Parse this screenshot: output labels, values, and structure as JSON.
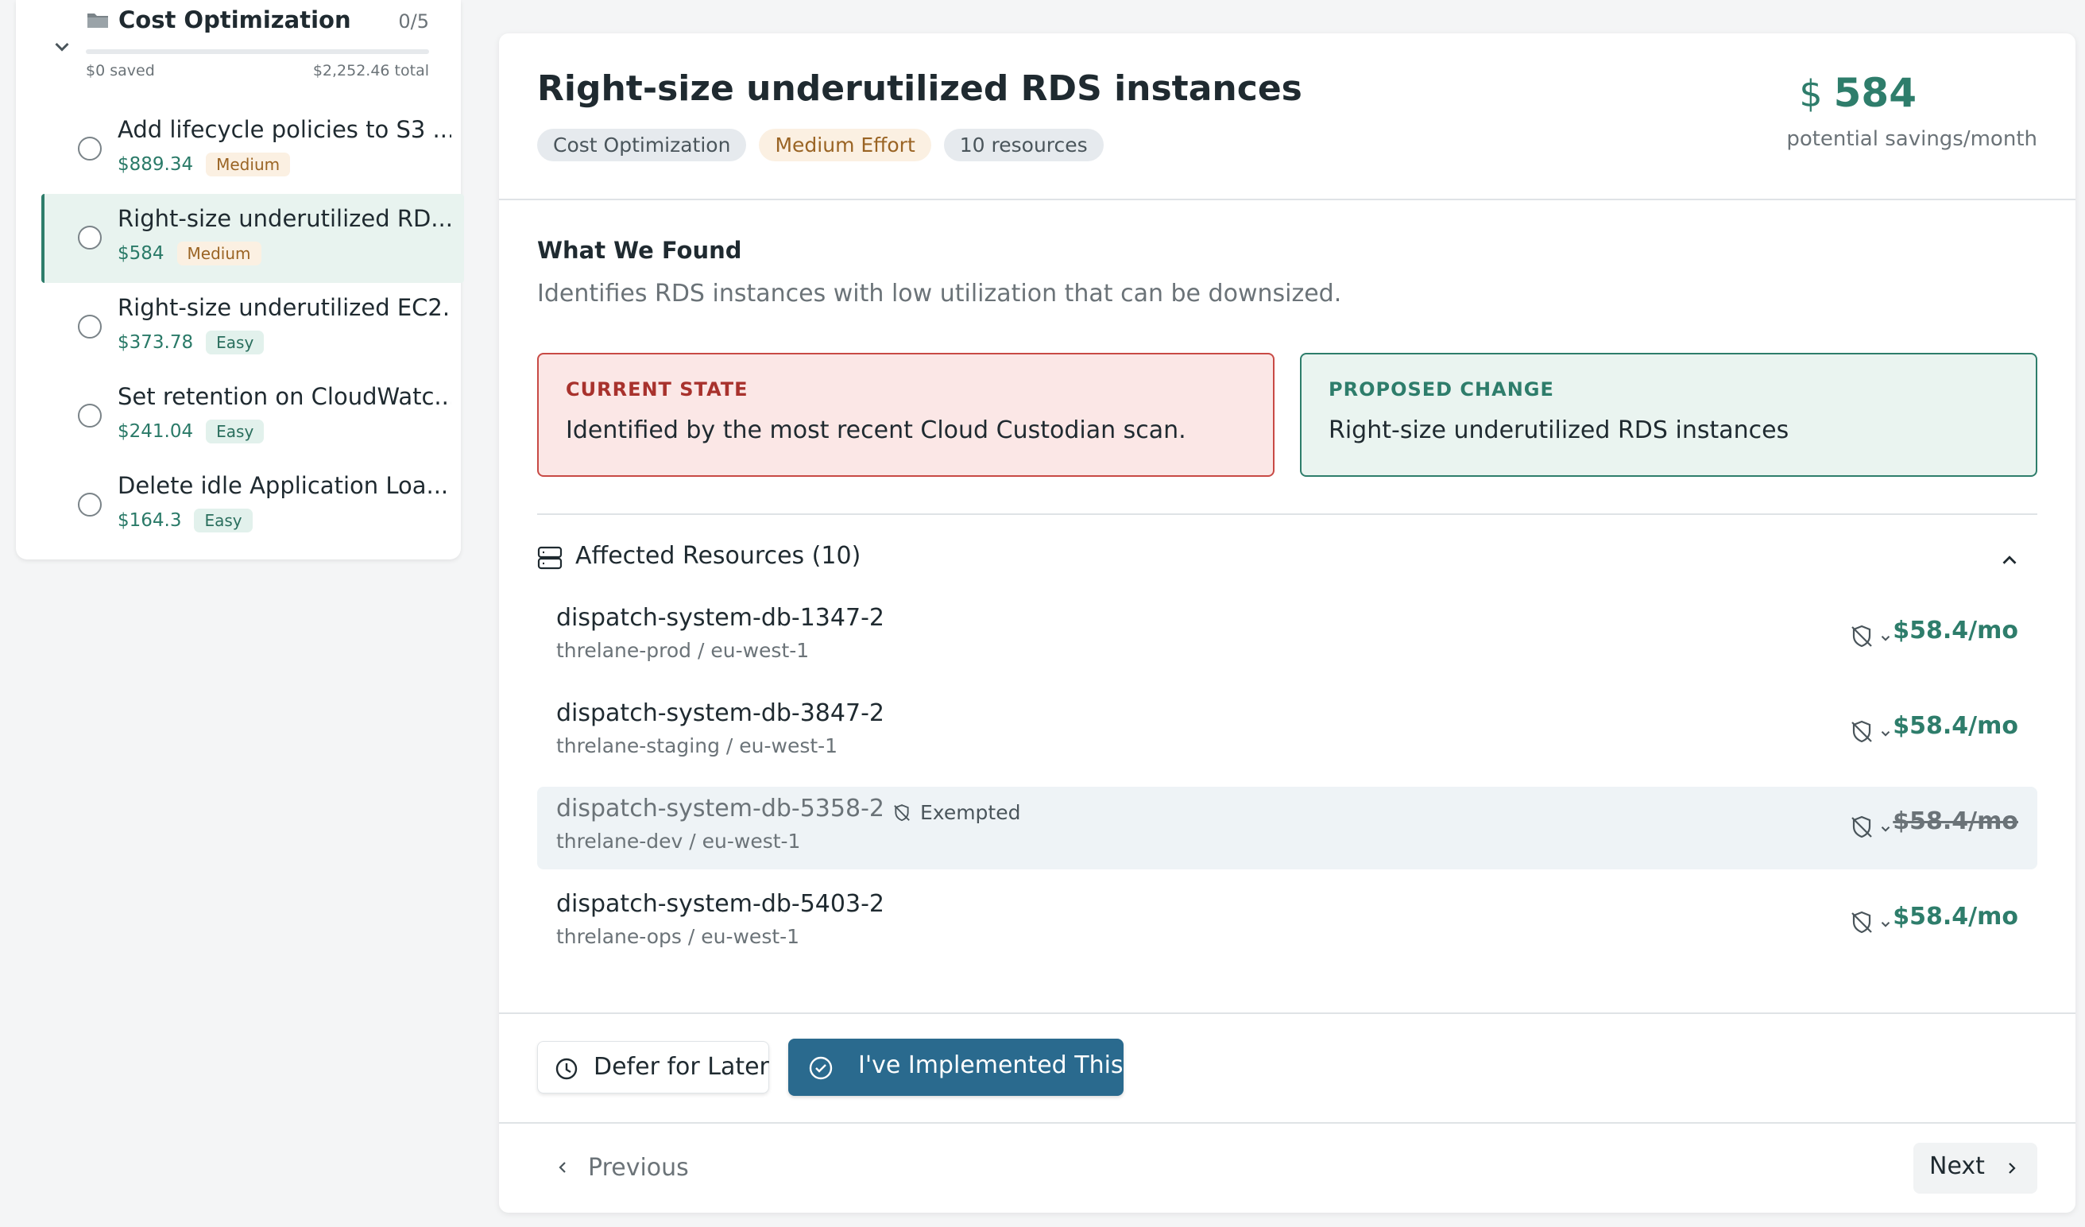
{
  "sidebar": {
    "group": {
      "title": "Cost Optimization",
      "count": "0/5",
      "saved": "$0 saved",
      "total": "$2,252.46 total",
      "progress_fraction": 0,
      "icon": "folder-icon"
    },
    "items": [
      {
        "title": "Add lifecycle policies to S3 ...",
        "price": "$889.34",
        "effort": "Medium",
        "effort_kind": "medium",
        "active": false
      },
      {
        "title": "Right-size underutilized RD...",
        "price": "$584",
        "effort": "Medium",
        "effort_kind": "medium",
        "active": true
      },
      {
        "title": "Right-size underutilized EC2...",
        "price": "$373.78",
        "effort": "Easy",
        "effort_kind": "easy",
        "active": false
      },
      {
        "title": "Set retention on CloudWatc...",
        "price": "$241.04",
        "effort": "Easy",
        "effort_kind": "easy",
        "active": false
      },
      {
        "title": "Delete idle Application Loa...",
        "price": "$164.3",
        "effort": "Easy",
        "effort_kind": "easy",
        "active": false
      }
    ]
  },
  "detail": {
    "title": "Right-size underutilized RDS instances",
    "tags": [
      "Cost Optimization",
      "Medium Effort",
      "10 resources"
    ],
    "savings": {
      "symbol": "$",
      "amount": "584",
      "label": "potential savings/month"
    },
    "found": {
      "title": "What We Found",
      "description": "Identifies RDS instances with low utilization that can be downsized."
    },
    "current_state": {
      "label": "CURRENT STATE",
      "text": "Identified by the most recent Cloud Custodian scan."
    },
    "proposed_change": {
      "label": "PROPOSED CHANGE",
      "text": "Right-size underutilized RDS instances"
    },
    "affected": {
      "title": "Affected Resources (10)",
      "resources": [
        {
          "name": "dispatch-system-db-1347-2",
          "location": "threlane-prod / eu-west-1",
          "cost": "$58.4/mo",
          "exempted": false
        },
        {
          "name": "dispatch-system-db-3847-2",
          "location": "threlane-staging / eu-west-1",
          "cost": "$58.4/mo",
          "exempted": false
        },
        {
          "name": "dispatch-system-db-5358-2",
          "location": "threlane-dev / eu-west-1",
          "cost": "$58.4/mo",
          "exempted": true,
          "badge": "Exempted"
        },
        {
          "name": "dispatch-system-db-5403-2",
          "location": "threlane-ops / eu-west-1",
          "cost": "$58.4/mo",
          "exempted": false
        }
      ]
    },
    "actions": {
      "defer": "Defer for Later",
      "implemented": "I've Implemented This"
    },
    "nav": {
      "previous": "Previous",
      "next": "Next"
    }
  },
  "colors": {
    "accent": "#2e7d6b",
    "primary_button": "#2a6a8e",
    "danger_border": "#c84a45",
    "danger_bg": "#fbe7e6",
    "success_bg": "#eaf4f0"
  }
}
